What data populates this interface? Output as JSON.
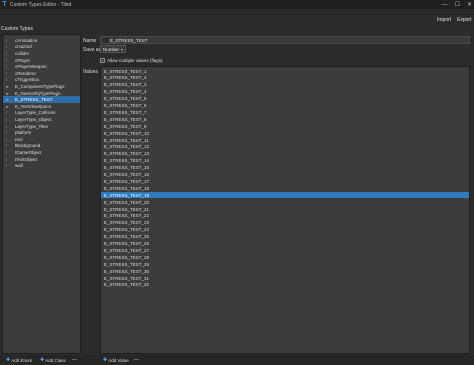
{
  "window": {
    "title": "Custom Types Editor - Tiled",
    "app_icon": "tiled-logo-icon",
    "controls": [
      "—",
      "☐",
      "✕"
    ],
    "heading": "Custom Types"
  },
  "toolbar": {
    "import_label": "Import",
    "export_label": "Export"
  },
  "types": {
    "items": [
      {
        "label": "cAnimation",
        "icon": "class-icon",
        "glyph": "⁝"
      },
      {
        "label": "cHazard",
        "icon": "class-icon",
        "glyph": "⁝"
      },
      {
        "label": "collider",
        "icon": "class-icon",
        "glyph": "⁝"
      },
      {
        "label": "cPlayer",
        "icon": "class-icon",
        "glyph": "⁝"
      },
      {
        "label": "cPlayerWeapon",
        "icon": "class-icon",
        "glyph": "⁝"
      },
      {
        "label": "cRenderer",
        "icon": "class-icon",
        "glyph": "⁝"
      },
      {
        "label": "cTriggerBox",
        "icon": "class-icon",
        "glyph": "⁝"
      },
      {
        "label": "E_ComponentTypeFlags",
        "icon": "enum-icon",
        "glyph": "≡"
      },
      {
        "label": "E_GameObjTypeFlags",
        "icon": "enum-icon",
        "glyph": "≡"
      },
      {
        "label": "E_STRESS_TEST",
        "icon": "enum-icon",
        "glyph": "≡"
      },
      {
        "label": "E_TextViewSpace",
        "icon": "enum-icon",
        "glyph": "≡"
      },
      {
        "label": "LayerType_Collision",
        "icon": "class-icon",
        "glyph": "⁝"
      },
      {
        "label": "LayerType_Object",
        "icon": "class-icon",
        "glyph": "⁝"
      },
      {
        "label": "LayerType_Tiles",
        "icon": "class-icon",
        "glyph": "⁝"
      },
      {
        "label": "platform",
        "icon": "class-icon",
        "glyph": "⁝"
      },
      {
        "label": "rect",
        "icon": "class-icon",
        "glyph": "⁝"
      },
      {
        "label": "tBackground",
        "icon": "class-icon",
        "glyph": "⁝"
      },
      {
        "label": "tGameObject",
        "icon": "class-icon",
        "glyph": "⁝"
      },
      {
        "label": "tTextObject",
        "icon": "class-icon",
        "glyph": "⁝"
      },
      {
        "label": "wall",
        "icon": "class-icon",
        "glyph": "⁝"
      }
    ],
    "selected_index": 9
  },
  "editor": {
    "name_label": "Name",
    "name_value": "E_STRESS_TEST",
    "save_as_label": "Save as",
    "save_as_value": "Number",
    "allow_flags_label": "Allow multiple values (flags)",
    "allow_flags_checked": true,
    "values_label": "Values",
    "values": [
      "E_STRESS_TEST_1",
      "E_STRESS_TEST_2",
      "E_STRESS_TEST_3",
      "E_STRESS_TEST_4",
      "E_STRESS_TEST_5",
      "E_STRESS_TEST_6",
      "E_STRESS_TEST_7",
      "E_STRESS_TEST_8",
      "E_STRESS_TEST_9",
      "E_STRESS_TEST_10",
      "E_STRESS_TEST_11",
      "E_STRESS_TEST_12",
      "E_STRESS_TEST_13",
      "E_STRESS_TEST_14",
      "E_STRESS_TEST_15",
      "E_STRESS_TEST_16",
      "E_STRESS_TEST_17",
      "E_STRESS_TEST_18",
      "E_STRESS_TEST_19",
      "E_STRESS_TEST_20",
      "E_STRESS_TEST_21",
      "E_STRESS_TEST_22",
      "E_STRESS_TEST_23",
      "E_STRESS_TEST_24",
      "E_STRESS_TEST_25",
      "E_STRESS_TEST_26",
      "E_STRESS_TEST_27",
      "E_STRESS_TEST_28",
      "E_STRESS_TEST_29",
      "E_STRESS_TEST_30",
      "E_STRESS_TEST_31",
      "E_STRESS_TEST_32"
    ],
    "selected_value_index": 18
  },
  "bottom": {
    "add_enum_label": "Add Enum",
    "add_class_label": "Add Class",
    "remove_glyph": "—",
    "add_value_label": "Add Value",
    "add_glyph": "✚"
  },
  "colors": {
    "selection": "#2f7bc0",
    "panel": "#3c3c3c",
    "background": "#2b2b2b",
    "accent_icon": "#3f8fe0"
  }
}
